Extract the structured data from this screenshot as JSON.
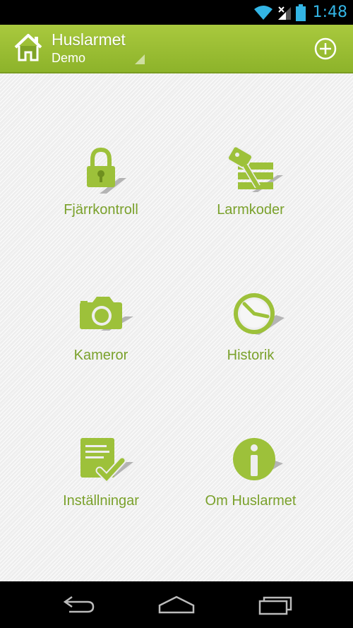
{
  "status_bar": {
    "time": "1:48",
    "icons": [
      "wifi-icon",
      "signal-icon",
      "battery-icon"
    ]
  },
  "action_bar": {
    "title": "Huslarmet",
    "subtitle": "Demo",
    "home_icon": "house-icon",
    "add_icon": "plus-circle-icon"
  },
  "menu": {
    "items": [
      {
        "label": "Fjärrkontroll",
        "icon": "padlock-icon"
      },
      {
        "label": "Larmkoder",
        "icon": "key-icon"
      },
      {
        "label": "Kameror",
        "icon": "camera-icon"
      },
      {
        "label": "Historik",
        "icon": "clock-icon"
      },
      {
        "label": "Inställningar",
        "icon": "checklist-icon"
      },
      {
        "label": "Om Huslarmet",
        "icon": "info-icon"
      }
    ]
  },
  "nav_bar": {
    "icons": [
      "back-icon",
      "home-icon",
      "recent-apps-icon"
    ]
  },
  "colors": {
    "accent": "#9dc13a",
    "label": "#7aa12b",
    "status_time": "#33b5e5"
  }
}
